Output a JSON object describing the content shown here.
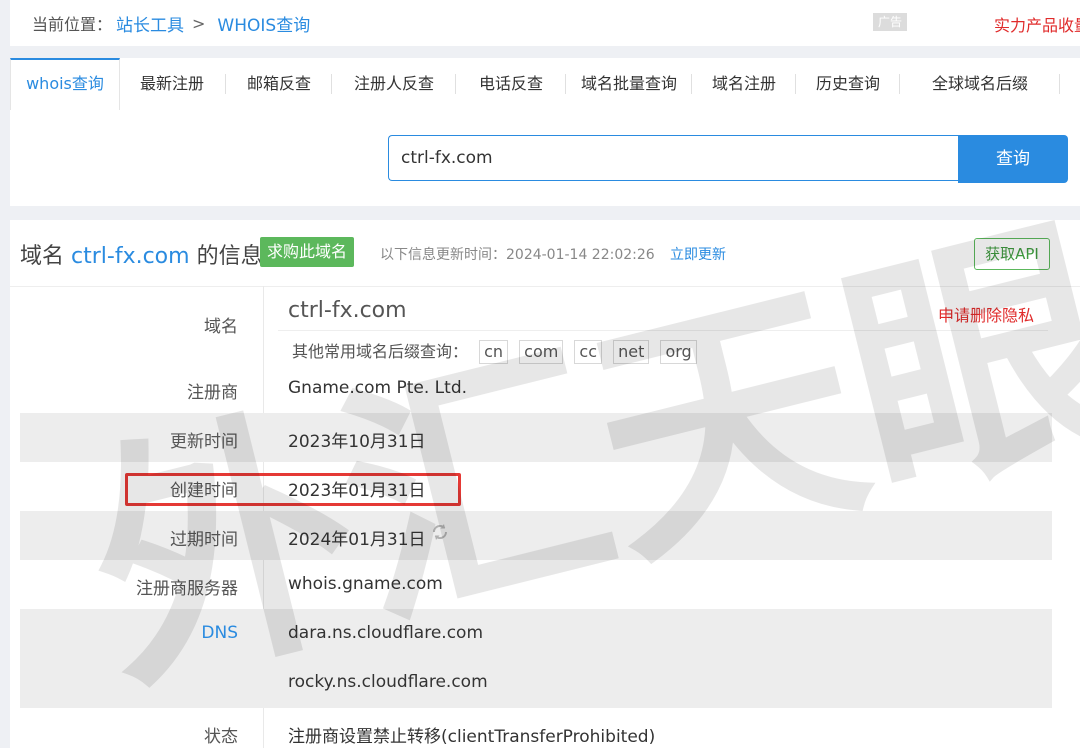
{
  "breadcrumb": {
    "label": "当前位置：",
    "items": [
      "站长工具",
      "WHOIS查询"
    ],
    "separator": ">"
  },
  "ad_label": "广告",
  "promo_text": "实力产品收量",
  "tabs": [
    {
      "label": "whois查询",
      "active": true
    },
    {
      "label": "最新注册"
    },
    {
      "label": "邮箱反查"
    },
    {
      "label": "注册人反查"
    },
    {
      "label": "电话反查"
    },
    {
      "label": "域名批量查询"
    },
    {
      "label": "域名注册"
    },
    {
      "label": "历史查询"
    },
    {
      "label": "全球域名后缀"
    }
  ],
  "search": {
    "value": "ctrl-fx.com",
    "button": "查询"
  },
  "panel": {
    "title_prefix": "域名",
    "title_domain": "ctrl-fx.com",
    "title_suffix": "的信息",
    "buy_badge": "求购此域名",
    "updated_text": "以下信息更新时间：2024-01-14 22:02:26",
    "refresh_link": "立即更新",
    "api_button": "获取API"
  },
  "domain_row": {
    "key": "域名",
    "value": "ctrl-fx.com",
    "delete_privacy": "申请删除隐私",
    "suffix_label": "其他常用域名后缀查询：",
    "suffixes": [
      "cn",
      "com",
      "cc",
      "net",
      "org"
    ]
  },
  "rows": [
    {
      "key": "注册商",
      "value": "Gname.com Pte. Ltd."
    },
    {
      "key": "更新时间",
      "value": "2023年10月31日"
    },
    {
      "key": "创建时间",
      "value": "2023年01月31日"
    },
    {
      "key": "过期时间",
      "value": "2024年01月31日"
    },
    {
      "key": "注册商服务器",
      "value": "whois.gname.com"
    },
    {
      "key": "DNS",
      "value": "dara.ns.cloudflare.com",
      "value2": "rocky.ns.cloudflare.com"
    },
    {
      "key": "状态",
      "value": "注册商设置禁止转移(clientTransferProhibited)"
    }
  ],
  "watermark_text": "外汇天眼",
  "colors": {
    "link": "#2a8be0",
    "accent_red": "#e02b2b",
    "green": "#5cb85c",
    "highlight_box": "#e53935"
  }
}
